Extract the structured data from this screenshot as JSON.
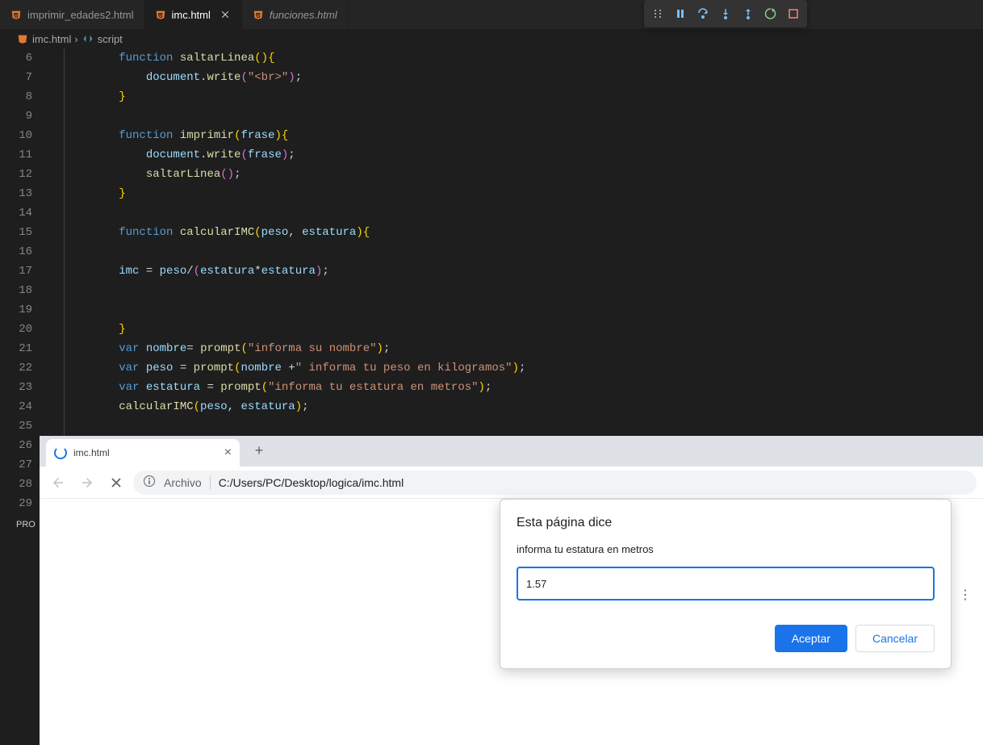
{
  "tabs": [
    {
      "label": "imprimir_edades2.html",
      "active": false,
      "italic": false
    },
    {
      "label": "imc.html",
      "active": true,
      "italic": false
    },
    {
      "label": "funciones.html",
      "active": false,
      "italic": true
    }
  ],
  "breadcrumbs": {
    "file": "imc.html",
    "symbol": "script"
  },
  "lineNumbers": [
    "6",
    "7",
    "8",
    "9",
    "10",
    "11",
    "12",
    "13",
    "14",
    "15",
    "16",
    "17",
    "18",
    "19",
    "20",
    "21",
    "22",
    "23",
    "24",
    "25",
    "26",
    "27",
    "28",
    "29"
  ],
  "code": {
    "l6": {
      "indent": "        ",
      "kw": "function ",
      "fn": "saltarLinea",
      "p1": "(",
      "p2": ")",
      "br": "{"
    },
    "l7": {
      "indent": "            ",
      "obj": "document",
      "dot": ".",
      "fn": "write",
      "p1": "(",
      "str": "\"<br>\"",
      "p2": ")",
      "semi": ";"
    },
    "l8": {
      "indent": "        ",
      "br": "}"
    },
    "l10": {
      "indent": "        ",
      "kw": "function ",
      "fn": "imprimir",
      "p1": "(",
      "arg": "frase",
      "p2": ")",
      "br": "{"
    },
    "l11": {
      "indent": "            ",
      "obj": "document",
      "dot": ".",
      "fn": "write",
      "p1": "(",
      "arg": "frase",
      "p2": ")",
      "semi": ";"
    },
    "l12": {
      "indent": "            ",
      "fn": "saltarLinea",
      "p1": "(",
      "p2": ")",
      "semi": ";"
    },
    "l13": {
      "indent": "        ",
      "br": "}"
    },
    "l15": {
      "indent": "        ",
      "kw": "function ",
      "fn": "calcularIMC",
      "p1": "(",
      "a1": "peso",
      "c": ", ",
      "a2": "estatura",
      "p2": ")",
      "br": "{"
    },
    "l17": {
      "indent": "        ",
      "v": "imc",
      "eq": " = ",
      "a1": "peso",
      "op1": "/",
      "p1": "(",
      "a2": "estatura",
      "op2": "*",
      "a3": "estatura",
      "p2": ")",
      "semi": ";"
    },
    "l20": {
      "indent": "        ",
      "br": "}"
    },
    "l21": {
      "indent": "        ",
      "kw": "var ",
      "v": "nombre",
      "eq": "= ",
      "fn": "prompt",
      "p1": "(",
      "str": "\"informa su nombre\"",
      "p2": ")",
      "semi": ";"
    },
    "l22": {
      "indent": "        ",
      "kw": "var ",
      "v": "peso",
      "eq": " = ",
      "fn": "prompt",
      "p1": "(",
      "a1": "nombre",
      "plus": " +",
      "str": "\" informa tu peso en kilogramos\"",
      "p2": ")",
      "semi": ";"
    },
    "l23": {
      "indent": "        ",
      "kw": "var ",
      "v": "estatura",
      "eq": " = ",
      "fn": "prompt",
      "p1": "(",
      "str": "\"informa tu estatura en metros\"",
      "p2": ")",
      "semi": ";"
    },
    "l24": {
      "indent": "        ",
      "fn": "calcularIMC",
      "p1": "(",
      "a1": "peso",
      "c": ", ",
      "a2": "estatura",
      "p2": ")",
      "semi": ";"
    }
  },
  "bottomLabel": "PRO",
  "browser": {
    "tabTitle": "imc.html",
    "addressPrefix": "Archivo",
    "url": "C:/Users/PC/Desktop/logica/imc.html"
  },
  "dialog": {
    "title": "Esta página dice",
    "message": "informa tu estatura en metros",
    "value": "1.57",
    "accept": "Aceptar",
    "cancel": "Cancelar"
  }
}
